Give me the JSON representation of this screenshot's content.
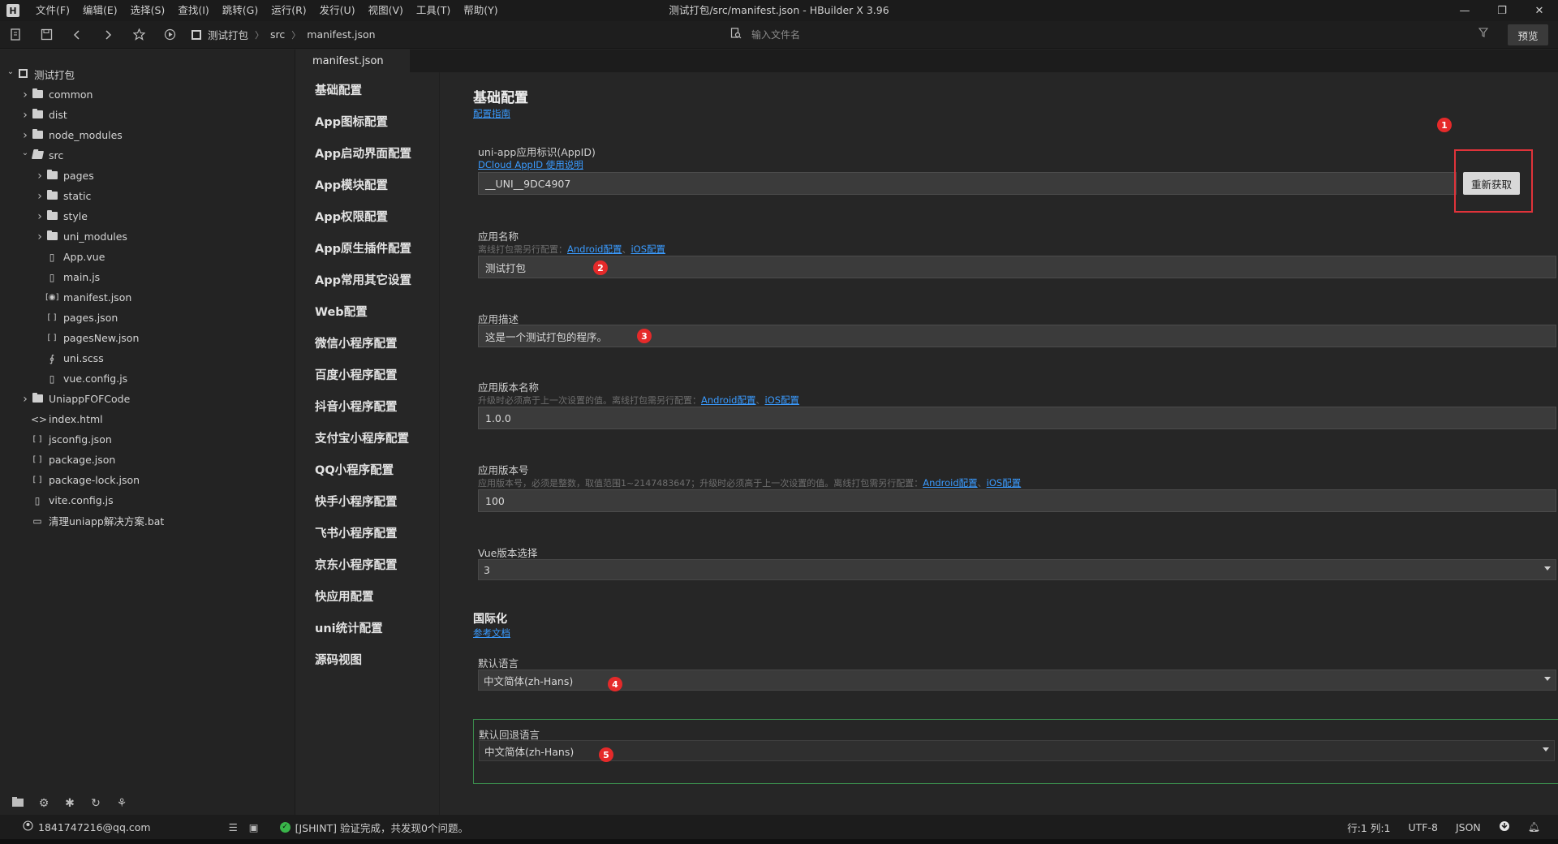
{
  "window": {
    "logo": "H",
    "title": "测试打包/src/manifest.json - HBuilder X 3.96",
    "menu": [
      "文件(F)",
      "编辑(E)",
      "选择(S)",
      "查找(I)",
      "跳转(G)",
      "运行(R)",
      "发行(U)",
      "视图(V)",
      "工具(T)",
      "帮助(Y)"
    ],
    "controls": {
      "minimize": "—",
      "restore": "❐",
      "close": "✕"
    }
  },
  "toolbar": {
    "breadcrumb": [
      "测试打包",
      "src",
      "manifest.json"
    ],
    "file_search_placeholder": "输入文件名",
    "preview_label": "预览"
  },
  "tree": [
    {
      "label": "测试打包",
      "indent": 0,
      "arrow": "expanded",
      "icon": "project"
    },
    {
      "label": "common",
      "indent": 1,
      "arrow": "collapsed",
      "icon": "folder"
    },
    {
      "label": "dist",
      "indent": 1,
      "arrow": "collapsed",
      "icon": "folder"
    },
    {
      "label": "node_modules",
      "indent": 1,
      "arrow": "collapsed",
      "icon": "folder"
    },
    {
      "label": "src",
      "indent": 1,
      "arrow": "expanded",
      "icon": "folder-open"
    },
    {
      "label": "pages",
      "indent": 2,
      "arrow": "collapsed",
      "icon": "folder"
    },
    {
      "label": "static",
      "indent": 2,
      "arrow": "collapsed",
      "icon": "folder"
    },
    {
      "label": "style",
      "indent": 2,
      "arrow": "collapsed",
      "icon": "folder"
    },
    {
      "label": "uni_modules",
      "indent": 2,
      "arrow": "collapsed",
      "icon": "folder"
    },
    {
      "label": "App.vue",
      "indent": 2,
      "arrow": "none",
      "icon": "file"
    },
    {
      "label": "main.js",
      "indent": 2,
      "arrow": "none",
      "icon": "file"
    },
    {
      "label": "manifest.json",
      "indent": 2,
      "arrow": "none",
      "icon": "manifest"
    },
    {
      "label": "pages.json",
      "indent": 2,
      "arrow": "none",
      "icon": "json"
    },
    {
      "label": "pagesNew.json",
      "indent": 2,
      "arrow": "none",
      "icon": "json"
    },
    {
      "label": "uni.scss",
      "indent": 2,
      "arrow": "none",
      "icon": "scss"
    },
    {
      "label": "vue.config.js",
      "indent": 2,
      "arrow": "none",
      "icon": "file"
    },
    {
      "label": "UniappFOFCode",
      "indent": 1,
      "arrow": "collapsed",
      "icon": "folder"
    },
    {
      "label": "index.html",
      "indent": 1,
      "arrow": "none",
      "icon": "html"
    },
    {
      "label": "jsconfig.json",
      "indent": 1,
      "arrow": "none",
      "icon": "json"
    },
    {
      "label": "package.json",
      "indent": 1,
      "arrow": "none",
      "icon": "json"
    },
    {
      "label": "package-lock.json",
      "indent": 1,
      "arrow": "none",
      "icon": "json"
    },
    {
      "label": "vite.config.js",
      "indent": 1,
      "arrow": "none",
      "icon": "file"
    },
    {
      "label": "清理uniapp解决方案.bat",
      "indent": 1,
      "arrow": "none",
      "icon": "bat"
    }
  ],
  "tab": {
    "label": "manifest.json"
  },
  "nav": [
    "基础配置",
    "App图标配置",
    "App启动界面配置",
    "App模块配置",
    "App权限配置",
    "App原生插件配置",
    "App常用其它设置",
    "Web配置",
    "微信小程序配置",
    "百度小程序配置",
    "抖音小程序配置",
    "支付宝小程序配置",
    "QQ小程序配置",
    "快手小程序配置",
    "飞书小程序配置",
    "京东小程序配置",
    "快应用配置",
    "uni统计配置",
    "源码视图"
  ],
  "main": {
    "title": "基础配置",
    "guide_link": "配置指南",
    "appid": {
      "label": "uni-app应用标识(AppID)",
      "link": "DCloud AppID 使用说明",
      "value": "__UNI__9DC4907",
      "button": "重新获取"
    },
    "app_name": {
      "label": "应用名称",
      "hint": "离线打包需另行配置：",
      "link_android": "Android配置",
      "sep": "、",
      "link_ios": "iOS配置",
      "value": "测试打包"
    },
    "app_desc": {
      "label": "应用描述",
      "value": "这是一个测试打包的程序。"
    },
    "version_name": {
      "label": "应用版本名称",
      "hint": "升级时必须高于上一次设置的值。离线打包需另行配置：",
      "link_android": "Android配置",
      "sep": "、",
      "link_ios": "iOS配置",
      "value": "1.0.0"
    },
    "version_code": {
      "label": "应用版本号",
      "hint": "应用版本号，必须是整数，取值范围1~2147483647；升级时必须高于上一次设置的值。离线打包需另行配置：",
      "link_android": "Android配置",
      "sep": "、",
      "link_ios": "iOS配置",
      "value": "100"
    },
    "vue_version": {
      "label": "Vue版本选择",
      "value": "3"
    },
    "i18n": {
      "title": "国际化",
      "link": "参考文档",
      "default_lang_label": "默认语言",
      "default_lang_value": "中文简体(zh-Hans)",
      "fallback_label": "默认回退语言",
      "fallback_value": "中文简体(zh-Hans)"
    },
    "badges": [
      "1",
      "2",
      "3",
      "4",
      "5"
    ]
  },
  "status": {
    "user": "1841747216@qq.com",
    "message": "[JSHINT] 验证完成，共发现0个问题。",
    "position": "行:1  列:1",
    "encoding": "UTF-8",
    "language": "JSON"
  }
}
